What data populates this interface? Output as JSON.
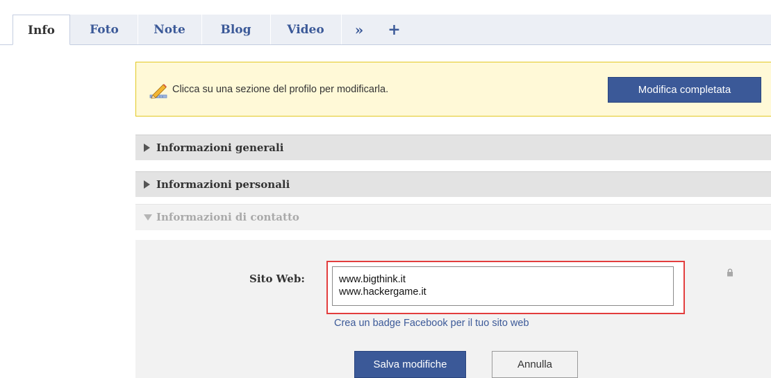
{
  "tabs": [
    {
      "label": "Info",
      "active": true
    },
    {
      "label": "Foto",
      "active": false
    },
    {
      "label": "Note",
      "active": false
    },
    {
      "label": "Blog",
      "active": false
    },
    {
      "label": "Video",
      "active": false
    },
    {
      "label": "»",
      "active": false
    },
    {
      "label": "+",
      "active": false
    }
  ],
  "notice": {
    "icon": "pencil-edit-icon",
    "text": "Clicca su una sezione del profilo per modificarla.",
    "button": "Modifica completata"
  },
  "sections": [
    {
      "title": "Informazioni generali",
      "state": "collapsed"
    },
    {
      "title": "Informazioni personali",
      "state": "collapsed"
    },
    {
      "title": "Informazioni di contatto",
      "state": "expanded"
    }
  ],
  "contact": {
    "website_label": "Sito Web:",
    "website_lines": [
      "www.bigthink.it",
      "www.hackergame.it"
    ],
    "lock_icon": "lock-icon",
    "badge_link": "Crea un badge Facebook per il tuo sito web",
    "save_button": "Salva modifiche",
    "cancel_button": "Annulla"
  },
  "colors": {
    "link": "#3b5998",
    "notice_bg": "#fff9d7",
    "notice_border": "#e2c822",
    "highlight": "#e23d3d"
  }
}
